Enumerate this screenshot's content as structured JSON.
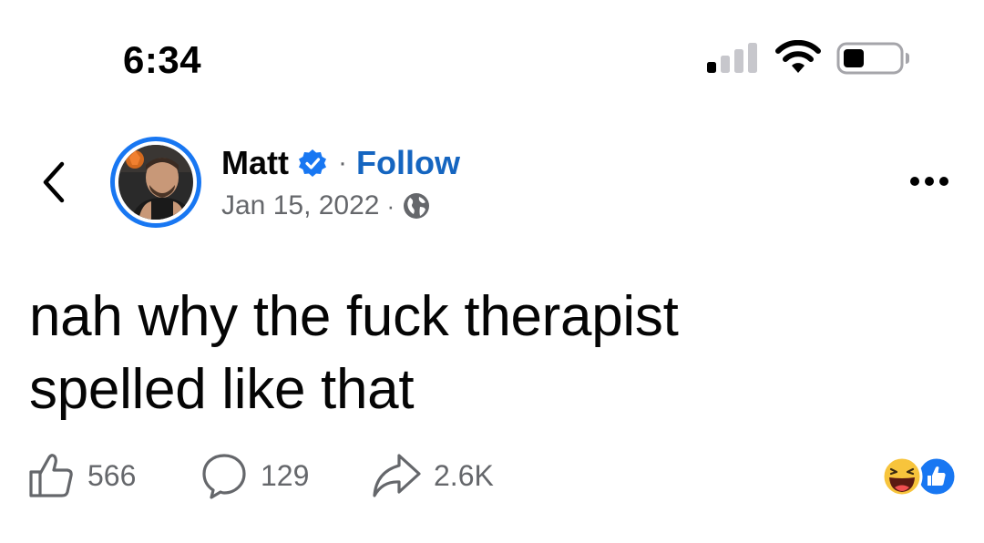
{
  "status_bar": {
    "time": "6:34"
  },
  "post": {
    "author": "Matt",
    "follow_label": "Follow",
    "separator": "·",
    "date": "Jan 15, 2022",
    "text_line1": "nah why the fuck therapist",
    "text_line2": "spelled like that"
  },
  "actions": {
    "like_count": "566",
    "comment_count": "129",
    "share_count": "2.6K"
  },
  "icons": {
    "back": "chevron-left-icon",
    "verified": "verified-badge-icon",
    "audience": "globe-icon",
    "more": "more-dots-icon",
    "like": "thumbs-up-icon",
    "comment": "comment-bubble-icon",
    "share": "share-arrow-icon",
    "reactions": [
      "haha-reaction-icon",
      "like-reaction-icon"
    ]
  },
  "colors": {
    "accent": "#1877f2",
    "follow": "#1565c0",
    "secondary_text": "#65676b",
    "text": "#050505"
  }
}
